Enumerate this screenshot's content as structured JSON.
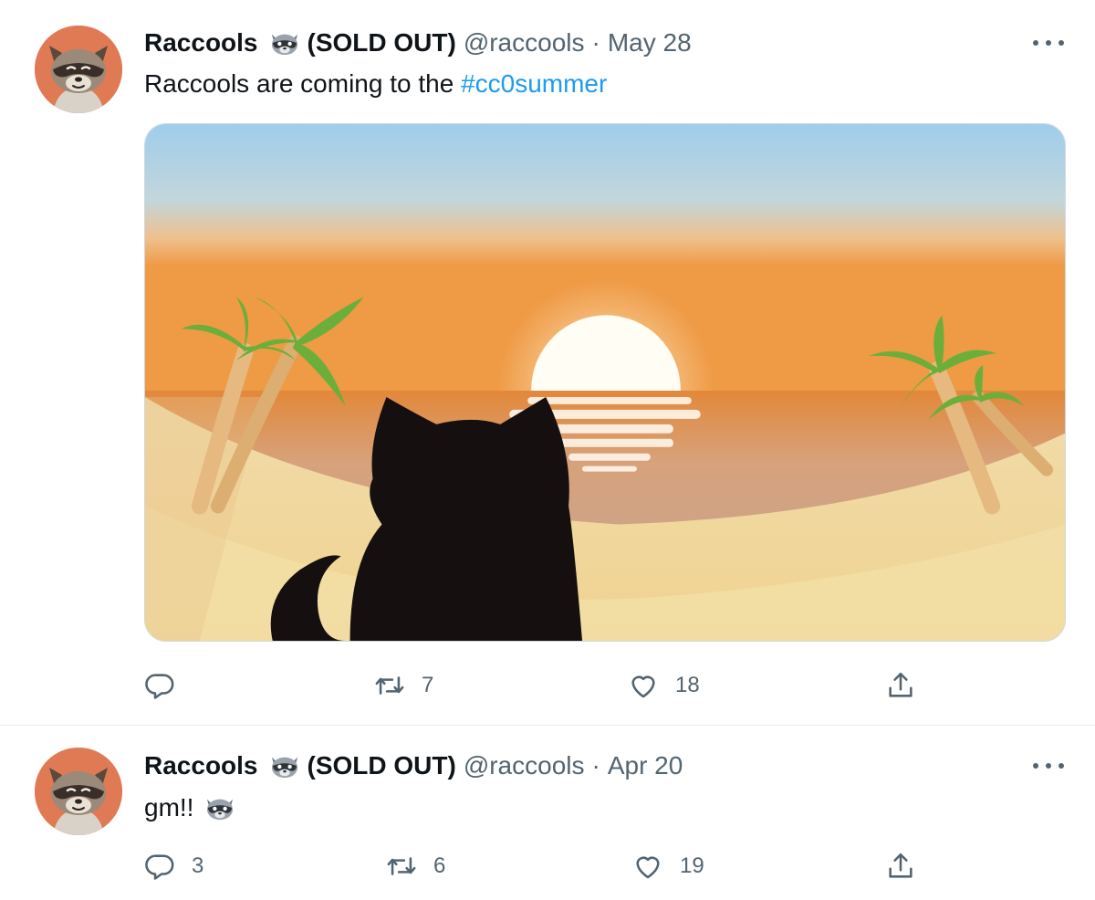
{
  "tweets": [
    {
      "display_name": "Raccools",
      "badge_text": "(SOLD OUT)",
      "handle": "@raccools",
      "separator": "·",
      "date": "May 28",
      "text_prefix": "Raccools are coming to the ",
      "hashtag": "#cc0summer",
      "media": "sunset-beach-cat-silhouette-image",
      "replies": "",
      "retweets": "7",
      "likes": "18"
    },
    {
      "display_name": "Raccools",
      "badge_text": "(SOLD OUT)",
      "handle": "@raccools",
      "separator": "·",
      "date": "Apr 20",
      "text_prefix": "gm!!",
      "text_emoji": "raccoon-emoji",
      "replies": "3",
      "retweets": "6",
      "likes": "19"
    }
  ],
  "icons": {
    "reply": "reply-icon",
    "retweet": "retweet-icon",
    "like": "heart-icon",
    "share": "share-icon",
    "more": "more-icon",
    "badge": "raccoon-emoji"
  },
  "colors": {
    "link": "#1d9bf0",
    "secondary_text": "#536471",
    "avatar_bg": "#e07a55"
  }
}
